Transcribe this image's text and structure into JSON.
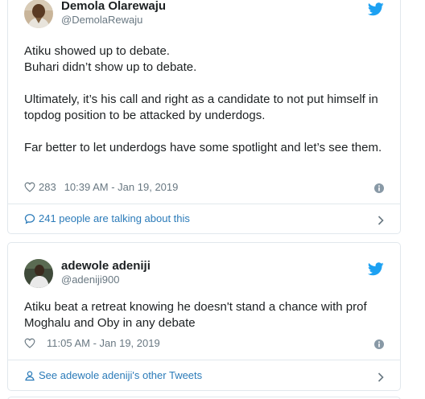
{
  "tweets": [
    {
      "author_name": "Demola Olarewaju",
      "author_handle": "@DemolaRewaju",
      "paragraphs": [
        "Atiku showed up to debate.",
        "Buhari didn’t show up to debate.",
        "",
        "Ultimately, it’s his call and right as a candidate to not put himself in topdog position to be attacked by underdogs.",
        "",
        "Far better to let underdogs have some spotlight and let’s see them."
      ],
      "likes": "283",
      "timestamp": "10:39 AM - Jan 19, 2019",
      "footer_text": "241 people are talking about this",
      "footer_icon": "speech-bubble-icon"
    },
    {
      "author_name": "adewole adeniji",
      "author_handle": "@adeniji900",
      "paragraphs": [
        "Atiku beat a retreat knowing he doesn't stand a chance with prof Moghalu and Oby in any debate"
      ],
      "likes": "",
      "timestamp": "11:05 AM - Jan 19, 2019",
      "footer_text": "See adewole adeniji's other Tweets",
      "footer_icon": "person-icon"
    }
  ],
  "colors": {
    "twitter_blue": "#1da1f2",
    "link": "#2b7bb9",
    "text": "#1c2022",
    "muted": "#697882",
    "border": "#e1e8ed"
  },
  "icons": [
    "twitter-bird-icon",
    "heart-icon",
    "info-icon",
    "chevron-right-icon"
  ]
}
